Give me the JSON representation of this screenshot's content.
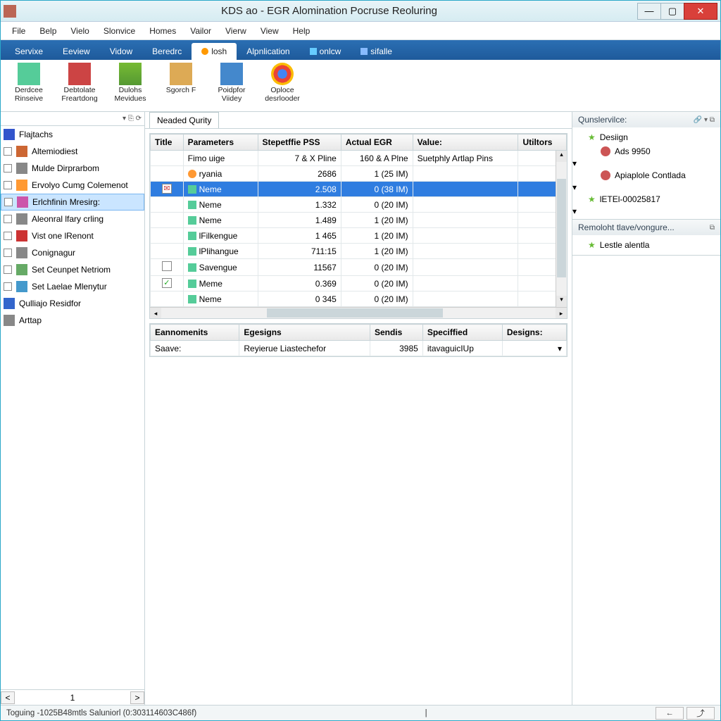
{
  "window": {
    "title": "KDS ao - EGR Alomination Pocruse Reoluring"
  },
  "menu": [
    "File",
    "Belp",
    "Vielo",
    "Slonvice",
    "Homes",
    "Vailor",
    "Vierw",
    "View",
    "Help"
  ],
  "ribbon_tabs": [
    {
      "label": "Servixe",
      "active": false
    },
    {
      "label": "Eeview",
      "active": false
    },
    {
      "label": "Vidow",
      "active": false
    },
    {
      "label": "Beredrc",
      "active": false
    },
    {
      "label": "losh",
      "active": true,
      "icon": "dot"
    },
    {
      "label": "Alpnlication",
      "active": false
    },
    {
      "label": "onlcw",
      "active": false,
      "icon": "sq"
    },
    {
      "label": "sifalle",
      "active": false,
      "icon": "sq2"
    }
  ],
  "ribbon_items": [
    {
      "label": "Derdcee Rinseive",
      "icon": "ic-green"
    },
    {
      "label": "Debtolate Freartdong",
      "icon": "ic-red"
    },
    {
      "label": "Dulohs Mevidues",
      "icon": "ic-shield"
    },
    {
      "label": "Sgorch F",
      "icon": "ic-box"
    },
    {
      "label": "Poidpfor Viidey",
      "icon": "ic-blue"
    },
    {
      "label": "Oploce desrlooder",
      "icon": "ic-chrome"
    }
  ],
  "sidebar": {
    "items": [
      {
        "label": "Flajtachs",
        "check": false
      },
      {
        "label": "Altemiodiest",
        "check": true
      },
      {
        "label": "Mulde Dirprarbom",
        "check": true
      },
      {
        "label": "Ervolyo Cumg Colemenot",
        "check": true
      },
      {
        "label": "Erlchfinin Mresirg:",
        "check": true,
        "selected": true
      },
      {
        "label": "Aleonral lfary crling",
        "check": true
      },
      {
        "label": "Vist one lRenont",
        "check": true
      },
      {
        "label": "Conignagur",
        "check": true
      },
      {
        "label": "Set Ceunpet Netriom",
        "check": true
      },
      {
        "label": "Set Laelae Mlenytur",
        "check": true
      },
      {
        "label": "Qulliajo Residfor",
        "check": false
      },
      {
        "label": "Arttap",
        "check": false
      }
    ],
    "page": "1"
  },
  "center_tab": "Neaded Qurity",
  "grid": {
    "headers": [
      "Title",
      "Parameters",
      "Stepetffie PSS",
      "Actual EGR",
      "Value:",
      "Utiltors"
    ],
    "rows": [
      {
        "ck": "",
        "p": "Fimo uige",
        "s": "7 & X Pline",
        "a": "160 & A Plne",
        "v": "Suetphly Artlap Pins",
        "icon": "none"
      },
      {
        "ck": "",
        "p": "ryania",
        "s": "2686",
        "a": "1 (25 IM)",
        "v": "",
        "icon": "orange"
      },
      {
        "ck": "red",
        "p": "Neme",
        "s": "2.508",
        "a": "0 (38 IM)",
        "v": "",
        "selected": true,
        "icon": "green"
      },
      {
        "ck": "",
        "p": "Neme",
        "s": "1.332",
        "a": "0 (20 IM)",
        "v": "",
        "icon": "green"
      },
      {
        "ck": "",
        "p": "Neme",
        "s": "1.489",
        "a": "1 (20 IM)",
        "v": "",
        "icon": "green"
      },
      {
        "ck": "",
        "p": "lFilkengue",
        "s": "1 465",
        "a": "1 (20 IM)",
        "v": "",
        "icon": "green"
      },
      {
        "ck": "",
        "p": "lPlihangue",
        "s": "711:15",
        "a": "1 (20 IM)",
        "v": "",
        "icon": "green"
      },
      {
        "ck": "box",
        "p": "Savengue",
        "s": "11567",
        "a": "0 (20 IM)",
        "v": "",
        "icon": "green"
      },
      {
        "ck": "green",
        "p": "Meme",
        "s": "0.369",
        "a": "0 (20 IM)",
        "v": "",
        "icon": "green"
      },
      {
        "ck": "",
        "p": "Neme",
        "s": "0 345",
        "a": "0 (20 IM)",
        "v": "",
        "icon": "green"
      }
    ]
  },
  "grid2": {
    "headers": [
      "Eannomenits",
      "Egesigns",
      "Sendis",
      "Speciffied",
      "Designs:"
    ],
    "row": {
      "a": "Saave:",
      "b": "Reyierue Liastechefor",
      "c": "3985",
      "d": "itavaguicIUp",
      "e": ""
    }
  },
  "rightpanel": {
    "sec1_title": "Qunslervilce:",
    "sec1_items": [
      {
        "label": "Desiign",
        "star": true,
        "indent": 0
      },
      {
        "label": "Ads 9950",
        "indent": 1,
        "exp": true
      },
      {
        "label": "Apiaplole Contlada",
        "indent": 1,
        "exp": true
      },
      {
        "label": "lETEl-00025817",
        "star": true,
        "indent": 0,
        "exp": true
      }
    ],
    "sec2_title": "Remoloht tlave/vongure...",
    "sec2_items": [
      {
        "label": "Lestle alentla",
        "star": true
      }
    ]
  },
  "statusbar": {
    "text": "Toguing -1025B48mtls Saluniorl (0:303114603C486f)"
  }
}
